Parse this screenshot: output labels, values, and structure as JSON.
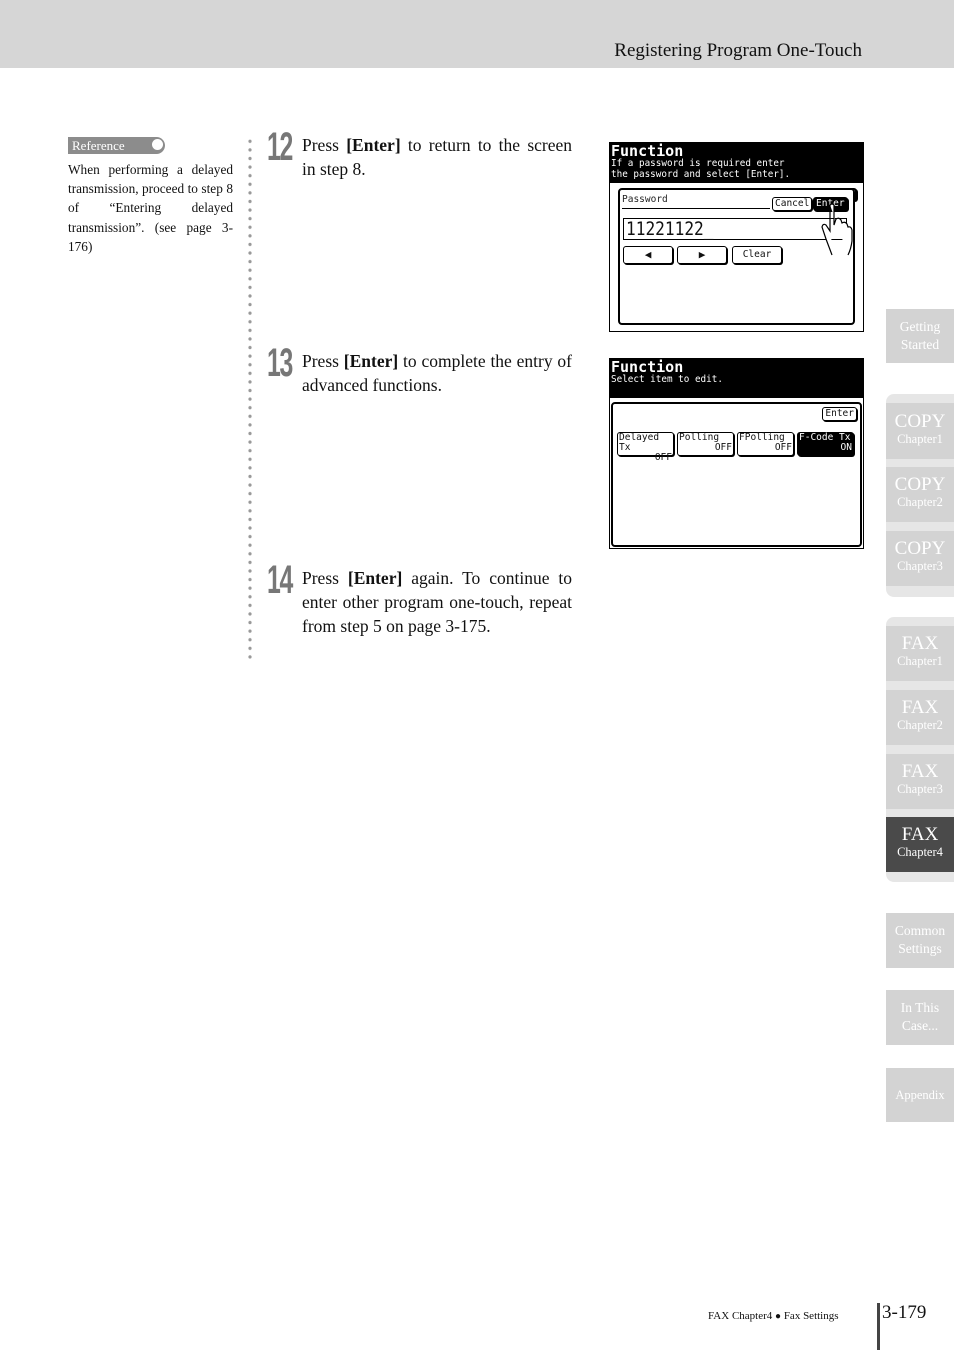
{
  "header": {
    "title": "Registering Program One-Touch"
  },
  "reference": {
    "badge": "Reference",
    "text": "When performing a delayed transmission, proceed to step 8 of “Entering delayed transmission”. (see page 3-176)"
  },
  "steps": [
    {
      "number": "12",
      "pre": "Press ",
      "key": "[Enter]",
      "post": " to return to the screen in step 8."
    },
    {
      "number": "13",
      "pre": "Press ",
      "key": "[Enter]",
      "post": " to complete the entry of advanced functions."
    },
    {
      "number": "14",
      "pre": "Press ",
      "key": "[Enter]",
      "post": " again. To continue to enter other program one-touch, repeat from step 5 on page 3-175."
    }
  ],
  "screen1": {
    "title": "Function",
    "subtitle_line1": "If a password is required enter",
    "subtitle_line2": "the password and select [Enter].",
    "behind_button": "Enter",
    "password_label": "Password",
    "cancel_button": "Cancel",
    "enter_button": "Enter",
    "password_value": "11221122_",
    "left_arrow": "◀",
    "right_arrow": "▶",
    "clear_button": "Clear",
    "pointer_icon": "hand-pointer"
  },
  "screen2": {
    "title": "Function",
    "subtitle": "Select item to edit.",
    "enter_button": "Enter",
    "items": [
      {
        "label": "Delayed Tx",
        "state": "OFF",
        "selected": false
      },
      {
        "label": "Polling",
        "state": "OFF",
        "selected": false
      },
      {
        "label": "FPolling",
        "state": "OFF",
        "selected": false
      },
      {
        "label": "F-Code Tx",
        "state": "ON",
        "selected": true
      }
    ]
  },
  "tabs": {
    "getting_started": {
      "line1": "Getting",
      "line2": "Started"
    },
    "copy": [
      {
        "main": "COPY",
        "sub": "Chapter1"
      },
      {
        "main": "COPY",
        "sub": "Chapter2"
      },
      {
        "main": "COPY",
        "sub": "Chapter3"
      }
    ],
    "fax": [
      {
        "main": "FAX",
        "sub": "Chapter1"
      },
      {
        "main": "FAX",
        "sub": "Chapter2"
      },
      {
        "main": "FAX",
        "sub": "Chapter3"
      },
      {
        "main": "FAX",
        "sub": "Chapter4",
        "active": true
      }
    ],
    "common_settings": {
      "line1": "Common",
      "line2": "Settings"
    },
    "in_this_case": {
      "line1": "In This",
      "line2": "Case..."
    },
    "appendix": {
      "line1": "Appendix"
    }
  },
  "footer": {
    "chapter": "FAX Chapter4",
    "bullet": "●",
    "section": "Fax Settings",
    "page": "3-179"
  },
  "colors": {
    "header_bg": "#d6d6d6",
    "tab_bg": "#d3d3d3",
    "tab_active": "#4a4a4a",
    "step_number": "#777777"
  }
}
